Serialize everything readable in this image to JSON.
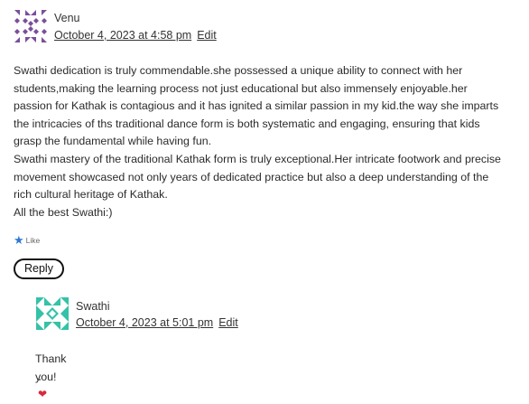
{
  "comments": [
    {
      "author": "Venu",
      "date": "October 4, 2023 at 4:58 pm",
      "edit": "Edit",
      "paragraphs": [
        "Swathi dedication is truly commendable.she possessed a unique ability to connect with her students,making the learning process not just educational but also immensely enjoyable.her passion for Kathak is contagious and it has ignited a similar passion in my kid.the way she imparts the intricacies of ths traditional dance form is both systematic and engaging, ensuring that kids grasp the fundamental while having fun.",
        "Swathi mastery of the traditional Kathak form is truly exceptional.Her intricate footwork and precise movement showcased not only years of dedicated practice but also a deep understanding of the rich cultural heritage of Kathak.",
        "All the best Swathi:)"
      ],
      "like_label": "Like",
      "reply_label": "Reply",
      "avatar_color": "#7a4f9a",
      "avatar_icon": "identicon"
    },
    {
      "author": "Swathi",
      "date": "October 4, 2023 at 5:01 pm",
      "edit": "Edit",
      "paragraphs": [
        "Thank you!"
      ],
      "heart_icon": "heart-icon",
      "avatar_color": "#34c2a8",
      "avatar_icon": "identicon"
    }
  ],
  "colors": {
    "like_star": "#2e7ad1",
    "heart": "#d9283f"
  }
}
